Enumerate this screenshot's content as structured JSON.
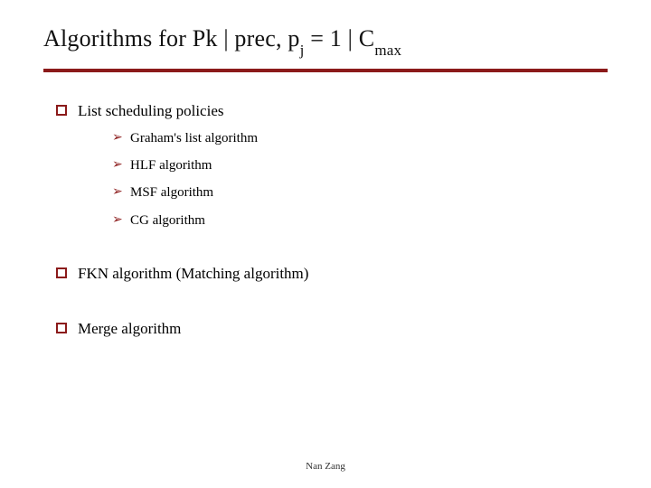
{
  "title": {
    "prefix": "Algorithms for Pk | prec, p",
    "sub1": "j",
    "mid": " = 1 | C",
    "sub2": "max"
  },
  "bullets": {
    "b1": "List scheduling policies",
    "b2": "FKN algorithm (Matching algorithm)",
    "b3": "Merge algorithm"
  },
  "subbullets": {
    "s1": "Graham's list algorithm",
    "s2": "HLF algorithm",
    "s3": "MSF algorithm",
    "s4": "CG algorithm"
  },
  "footer": "Nan Zang"
}
